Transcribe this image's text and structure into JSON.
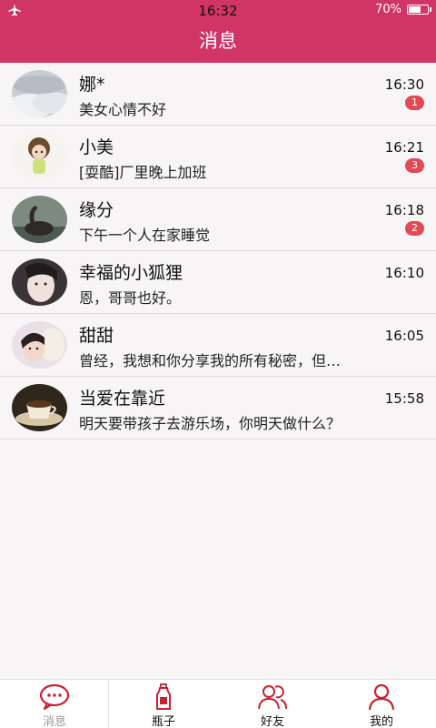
{
  "status_bar": {
    "time": "16:32",
    "battery": "70%",
    "battery_level": 0.7
  },
  "header": {
    "title": "消息"
  },
  "conversations": [
    {
      "name": "娜*",
      "message": "美女心情不好",
      "time": "16:30",
      "unread": "1",
      "avatar": "cloud-sky-avatar"
    },
    {
      "name": "小美",
      "message": "[耍酷]厂里晚上加班",
      "time": "16:21",
      "unread": "3",
      "avatar": "doll-avatar"
    },
    {
      "name": "缘分",
      "message": "下午一个人在家睡觉",
      "time": "16:18",
      "unread": "2",
      "avatar": "swan-avatar"
    },
    {
      "name": "幸福的小狐狸",
      "message": "恩，哥哥也好。",
      "time": "16:10",
      "unread": "",
      "avatar": "girl-portrait-avatar"
    },
    {
      "name": "甜甜",
      "message": "曾经，我想和你分享我的所有秘密，但…",
      "time": "16:05",
      "unread": "",
      "avatar": "girl-with-bear-avatar"
    },
    {
      "name": "当爱在靠近",
      "message": "明天要带孩子去游乐场，你明天做什么？",
      "time": "15:58",
      "unread": "",
      "avatar": "coffee-cup-avatar"
    }
  ],
  "tabs": [
    {
      "label": "消息",
      "icon": "chat-bubble-icon",
      "active": true
    },
    {
      "label": "瓶子",
      "icon": "bottle-icon",
      "active": false
    },
    {
      "label": "好友",
      "icon": "friends-icon",
      "active": false
    },
    {
      "label": "我的",
      "icon": "profile-icon",
      "active": false
    }
  ],
  "colors": {
    "accent": "#d13466",
    "badge": "#e24a55",
    "tab_icon": "#c9202f"
  }
}
